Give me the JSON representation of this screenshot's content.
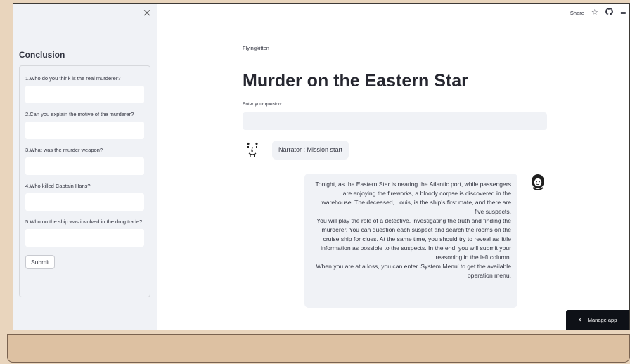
{
  "sidebar": {
    "close_icon": "×",
    "heading": "Conclusion",
    "questions": [
      {
        "label": "1.Who do you think is the real murderer?",
        "value": ""
      },
      {
        "label": "2.Can you explain the motive of the murderer?",
        "value": ""
      },
      {
        "label": "3.What was the murder weapon?",
        "value": ""
      },
      {
        "label": "4.Who killed Captain Hans?",
        "value": ""
      },
      {
        "label": "5.Who on the ship was involved in the drug trade?",
        "value": ""
      }
    ],
    "submit_label": "Submit"
  },
  "toolbar": {
    "share_label": "Share",
    "star_icon": "☆",
    "github_icon": "github-icon",
    "menu_icon": "≡"
  },
  "main": {
    "author": "Flyingkitten",
    "title": "Murder on the Eastern Star",
    "input_label": "Enter your quesion:",
    "input_value": ""
  },
  "chat": {
    "narrator_message": "Narrator : Mission start",
    "story_message": "Tonight, as the Eastern Star is nearing the Atlantic port, while passengers are enjoying the fireworks, a bloody corpse is discovered in the warehouse. The deceased, Louis, is the ship's first mate, and there are five suspects.\nYou will play the role of a detective, investigating the truth and finding the murderer. You can question each suspect and search the rooms on the cruise ship for clues. At the same time, you should try to reveal as little information as possible to the suspects. In the end, you will submit your reasoning in the left column.\nWhen you are at a loss, you can enter 'System Menu' to get the available operation menu."
  },
  "footer": {
    "manage_label": "Manage app",
    "chevron_icon": "‹"
  }
}
